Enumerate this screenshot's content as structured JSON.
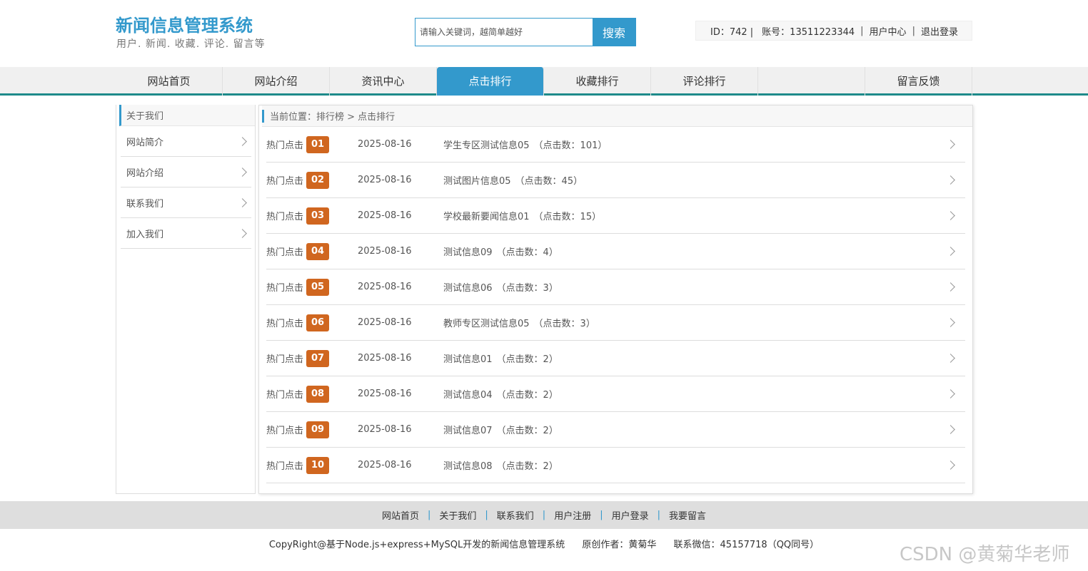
{
  "header": {
    "title": "新闻信息管理系统",
    "subtitle": "用户. 新闻. 收藏. 评论. 留言等",
    "search_placeholder": "请输入关键词，越简单越好",
    "search_button": "搜索",
    "user_id": "ID：742 |",
    "account": "账号：13511223344",
    "user_center": "用户中心",
    "logout": "退出登录"
  },
  "nav": {
    "items": [
      "网站首页",
      "网站介绍",
      "资讯中心",
      "点击排行",
      "收藏排行",
      "评论排行",
      "",
      "留言反馈"
    ],
    "active_index": 3
  },
  "sidebar": {
    "heading": "关于我们",
    "items": [
      "网站简介",
      "网站介绍",
      "联系我们",
      "加入我们"
    ]
  },
  "breadcrumb": "当前位置：排行榜 > 点击排行",
  "ranking": {
    "label": "热门点击",
    "rows": [
      {
        "rank": "01",
        "date": "2025-08-16",
        "title": "学生专区测试信息05",
        "clicks": "（点击数：101）"
      },
      {
        "rank": "02",
        "date": "2025-08-16",
        "title": "测试图片信息05",
        "clicks": "（点击数：45）"
      },
      {
        "rank": "03",
        "date": "2025-08-16",
        "title": "学校最新要闻信息01",
        "clicks": "（点击数：15）"
      },
      {
        "rank": "04",
        "date": "2025-08-16",
        "title": "测试信息09",
        "clicks": "（点击数：4）"
      },
      {
        "rank": "05",
        "date": "2025-08-16",
        "title": "测试信息06",
        "clicks": "（点击数：3）"
      },
      {
        "rank": "06",
        "date": "2025-08-16",
        "title": "教师专区测试信息05",
        "clicks": "（点击数：3）"
      },
      {
        "rank": "07",
        "date": "2025-08-16",
        "title": "测试信息01",
        "clicks": "（点击数：2）"
      },
      {
        "rank": "08",
        "date": "2025-08-16",
        "title": "测试信息04",
        "clicks": "（点击数：2）"
      },
      {
        "rank": "09",
        "date": "2025-08-16",
        "title": "测试信息07",
        "clicks": "（点击数：2）"
      },
      {
        "rank": "10",
        "date": "2025-08-16",
        "title": "测试信息08",
        "clicks": "（点击数：2）"
      }
    ]
  },
  "footer": {
    "links": [
      "网站首页",
      "关于我们",
      "联系我们",
      "用户注册",
      "用户登录",
      "我要留言"
    ],
    "copyright": "CopyRight@基于Node.js+express+MySQL开发的新闻信息管理系统",
    "author": "原创作者：黄菊华",
    "contact": "联系微信：45157718（QQ同号）"
  },
  "watermark": "CSDN @黄菊华老师",
  "colors": {
    "accent": "#3399cc",
    "rank_badge": "#d0661f",
    "nav_border": "#1e8a8a"
  }
}
